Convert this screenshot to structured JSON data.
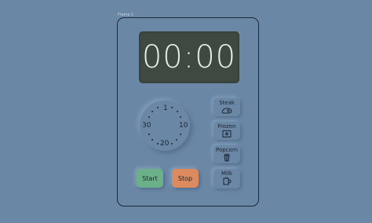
{
  "frame": {
    "label": "Frame 1"
  },
  "display": {
    "time": "00:00"
  },
  "dial": {
    "marks": [
      "1",
      "10",
      "20",
      "30"
    ]
  },
  "controls": {
    "start_label": "Start",
    "stop_label": "Stop"
  },
  "presets": [
    {
      "label": "Steak",
      "icon": "steak-icon"
    },
    {
      "label": "Frozen",
      "icon": "frozen-icon"
    },
    {
      "label": "Popcorn",
      "icon": "popcorn-icon"
    },
    {
      "label": "Milk",
      "icon": "milk-icon"
    }
  ],
  "colors": {
    "background": "#6b87a6",
    "display": "#3f4940",
    "start": "#6bb088",
    "stop": "#dd8a5e"
  }
}
